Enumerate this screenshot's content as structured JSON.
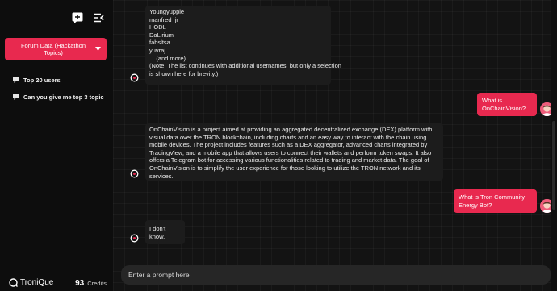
{
  "sidebar": {
    "topic_selector": {
      "label": "Forum Data (Hackathon Topics)"
    },
    "history": [
      {
        "label": "Top 20 users"
      },
      {
        "label": "Can you give me top 3 topic"
      }
    ],
    "footer": {
      "brand": "TroniQue",
      "credits_value": "93",
      "credits_label": "Credits"
    }
  },
  "chat": {
    "message_1_lines": [
      "Youngyuppie",
      "manfred_jr",
      "HODL",
      "DaLirium",
      "fabsltsa",
      "yuvraj",
      "... (and more)",
      "(Note: The list continues with additional usernames, but only a selection",
      "is shown here for brevity.)"
    ],
    "user_message_1": "What is OnChainVision?",
    "bot_message_2": "OnChainVision is a project aimed at providing an aggregated decentralized exchange (DEX) platform with visual data over the TRON blockchain, including charts and an easy way to interact with the chain using mobile devices. The project includes features such as a DEX aggregator, advanced charts integrated by TradingView, and a mobile app that allows users to connect their wallets and perform token swaps. It also offers a Telegram bot for accessing various functionalities related to trading and market data. The goal of OnChainVision is to simplify the user experience for those looking to utilize the TRON network and its services.",
    "user_message_2": "What is Tron Community Energy Bot?",
    "bot_message_3": "I don't know."
  },
  "composer": {
    "placeholder": "Enter a prompt here"
  },
  "colors": {
    "accent": "#e8294f",
    "background": "#131313",
    "sidebar": "#0d0d0d",
    "bubble": "#1c1c1c"
  }
}
